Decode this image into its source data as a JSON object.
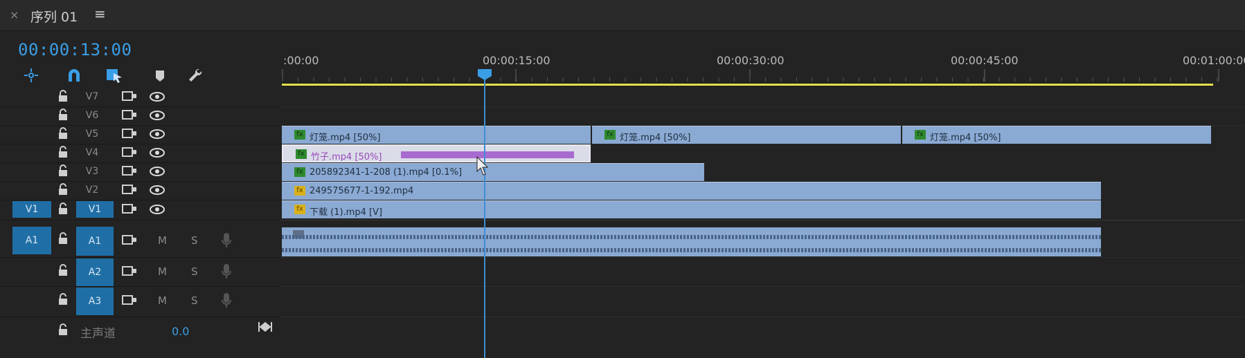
{
  "header": {
    "close": "×",
    "sequence_title": "序列 01",
    "menu": "≡"
  },
  "timecode": "00:00:13:00",
  "toolbar": [
    "nest-tool-icon",
    "snap-magnet-icon",
    "linked-selection-icon",
    "marker-icon",
    "settings-wrench-icon"
  ],
  "video_tracks": [
    {
      "id": "V7",
      "label": "V7"
    },
    {
      "id": "V6",
      "label": "V6"
    },
    {
      "id": "V5",
      "label": "V5"
    },
    {
      "id": "V4",
      "label": "V4"
    },
    {
      "id": "V3",
      "label": "V3"
    },
    {
      "id": "V2",
      "label": "V2"
    },
    {
      "id": "V1",
      "label": "V1",
      "source_patch": "V1"
    }
  ],
  "audio_tracks": [
    {
      "id": "A1",
      "label": "A1",
      "source_patch": "A1",
      "mute": "M",
      "solo": "S"
    },
    {
      "id": "A2",
      "label": "A2",
      "mute": "M",
      "solo": "S"
    },
    {
      "id": "A3",
      "label": "A3",
      "mute": "M",
      "solo": "S"
    }
  ],
  "master": {
    "label": "主声道",
    "value": "0.0"
  },
  "ruler": {
    "labels": [
      ":00:00",
      "00:00:15:00",
      "00:00:30:00",
      "00:00:45:00",
      "00:01:00:00"
    ]
  },
  "clips": {
    "v5a": "灯笼.mp4 [50%]",
    "v5b": "灯笼.mp4 [50%]",
    "v5c": "灯笼.mp4 [50%]",
    "v4": "竹子.mp4 [50%]",
    "v3": "205892341-1-208 (1).mp4 [0.1%]",
    "v2": "249575677-1-192.mp4",
    "v1": "下载 (1).mp4 [V]"
  },
  "fx": "fx"
}
